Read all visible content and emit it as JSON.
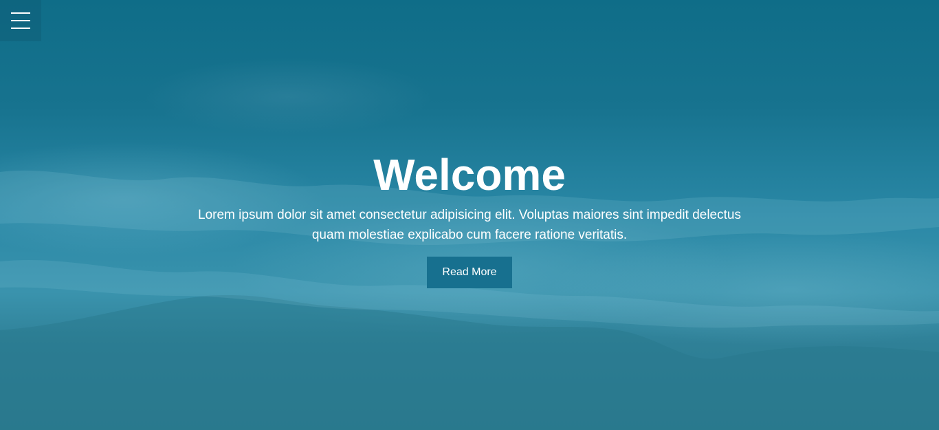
{
  "nav": {
    "menu_icon": "hamburger-menu-icon"
  },
  "hero": {
    "title": "Welcome",
    "text": "Lorem ipsum dolor sit amet consectetur adipisicing elit. Voluptas maiores sint impedit delectus quam molestiae explicabo cum facere ratione veritatis.",
    "button_label": "Read More"
  },
  "colors": {
    "overlay": "#1a7a96",
    "button": "#17708f",
    "text": "#ffffff"
  }
}
